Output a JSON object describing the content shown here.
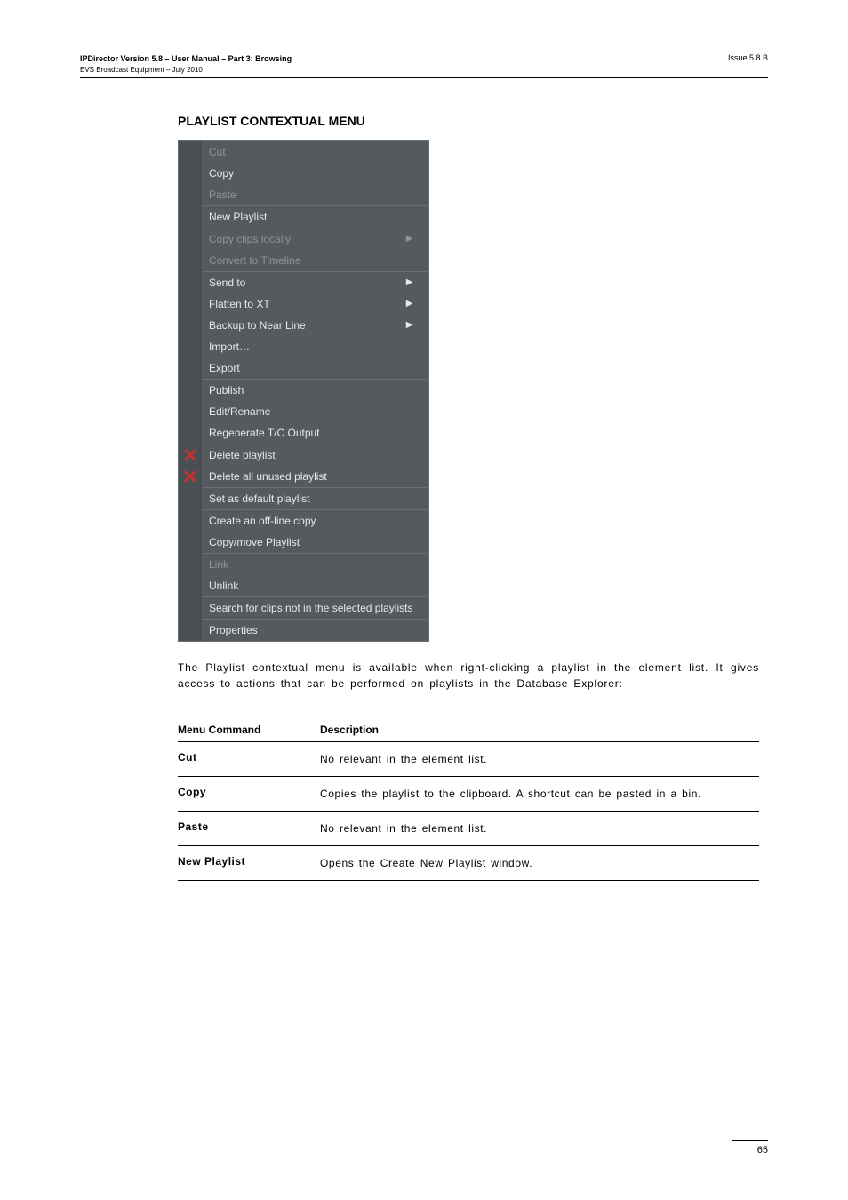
{
  "header": {
    "title_line1": "IPDirector Version 5.8 – User Manual – Part 3: Browsing",
    "title_line2": "EVS Broadcast Equipment – July 2010",
    "issue": "Issue 5.8.B"
  },
  "section_title": "PLAYLIST CONTEXTUAL MENU",
  "context_menu": {
    "items": [
      {
        "label": "Cut",
        "disabled": true
      },
      {
        "label": "Copy"
      },
      {
        "label": "Paste",
        "disabled": true
      },
      {
        "sep": true
      },
      {
        "label": "New Playlist"
      },
      {
        "sep": true
      },
      {
        "label": "Copy clips locally",
        "disabled": true,
        "arrow": true
      },
      {
        "label": "Convert to Timeline",
        "disabled": true
      },
      {
        "sep": true
      },
      {
        "label": "Send to",
        "arrow": true
      },
      {
        "label": "Flatten to XT",
        "arrow": true
      },
      {
        "label": "Backup to Near Line",
        "arrow": true
      },
      {
        "label": "Import…"
      },
      {
        "label": "Export"
      },
      {
        "sep": true
      },
      {
        "label": "Publish"
      },
      {
        "label": "Edit/Rename"
      },
      {
        "label": "Regenerate T/C Output"
      },
      {
        "sep": true
      },
      {
        "label": "Delete playlist",
        "icon": "x"
      },
      {
        "label": "Delete all unused playlist",
        "icon": "x"
      },
      {
        "sep": true
      },
      {
        "label": "Set as default playlist"
      },
      {
        "sep": true
      },
      {
        "label": "Create an off-line copy"
      },
      {
        "label": "Copy/move Playlist"
      },
      {
        "sep": true
      },
      {
        "label": "Link",
        "disabled": true
      },
      {
        "label": "Unlink"
      },
      {
        "sep": true
      },
      {
        "label": "Search for clips not in the selected playlists"
      },
      {
        "sep": true
      },
      {
        "label": "Properties"
      }
    ]
  },
  "description": "The Playlist contextual menu is available when right-clicking a playlist in the element list. It gives access to actions that can be performed on playlists in the Database Explorer:",
  "table": {
    "head_cmd": "Menu Command",
    "head_desc": "Description",
    "rows": [
      {
        "cmd": "Cut",
        "desc": "No relevant in the element list."
      },
      {
        "cmd": "Copy",
        "desc": "Copies the playlist to the clipboard. A shortcut can be pasted in a bin."
      },
      {
        "cmd": "Paste",
        "desc": "No relevant in the element list."
      },
      {
        "cmd": "New Playlist",
        "desc": "Opens the Create New Playlist window."
      }
    ]
  },
  "page_number": "65"
}
